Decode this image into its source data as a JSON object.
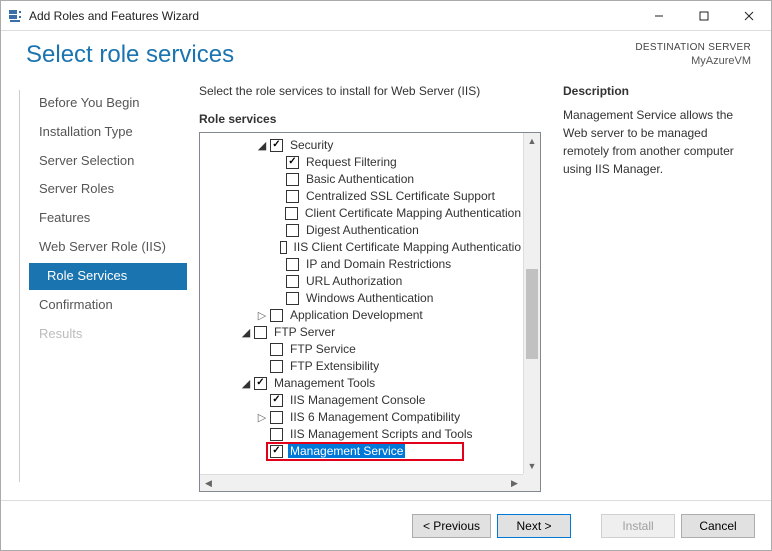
{
  "window": {
    "title": "Add Roles and Features Wizard"
  },
  "header": {
    "pageTitle": "Select role services",
    "destLabel": "DESTINATION SERVER",
    "destName": "MyAzureVM"
  },
  "steps": [
    {
      "label": "Before You Begin",
      "state": "normal"
    },
    {
      "label": "Installation Type",
      "state": "normal"
    },
    {
      "label": "Server Selection",
      "state": "normal"
    },
    {
      "label": "Server Roles",
      "state": "normal"
    },
    {
      "label": "Features",
      "state": "normal"
    },
    {
      "label": "Web Server Role (IIS)",
      "state": "normal"
    },
    {
      "label": "Role Services",
      "state": "active"
    },
    {
      "label": "Confirmation",
      "state": "normal"
    },
    {
      "label": "Results",
      "state": "disabled"
    }
  ],
  "instruction": "Select the role services to install for Web Server (IIS)",
  "rolesLabel": "Role services",
  "tree": [
    {
      "depth": 3,
      "expander": "▲",
      "checked": true,
      "label": "Security"
    },
    {
      "depth": 4,
      "expander": "",
      "checked": true,
      "label": "Request Filtering"
    },
    {
      "depth": 4,
      "expander": "",
      "checked": false,
      "label": "Basic Authentication"
    },
    {
      "depth": 4,
      "expander": "",
      "checked": false,
      "label": "Centralized SSL Certificate Support"
    },
    {
      "depth": 4,
      "expander": "",
      "checked": false,
      "label": "Client Certificate Mapping Authentication"
    },
    {
      "depth": 4,
      "expander": "",
      "checked": false,
      "label": "Digest Authentication"
    },
    {
      "depth": 4,
      "expander": "",
      "checked": false,
      "label": "IIS Client Certificate Mapping Authenticatio"
    },
    {
      "depth": 4,
      "expander": "",
      "checked": false,
      "label": "IP and Domain Restrictions"
    },
    {
      "depth": 4,
      "expander": "",
      "checked": false,
      "label": "URL Authorization"
    },
    {
      "depth": 4,
      "expander": "",
      "checked": false,
      "label": "Windows Authentication"
    },
    {
      "depth": 3,
      "expander": "▷",
      "checked": false,
      "label": "Application Development"
    },
    {
      "depth": 2,
      "expander": "▲",
      "checked": false,
      "label": "FTP Server"
    },
    {
      "depth": 3,
      "expander": "",
      "checked": false,
      "label": "FTP Service"
    },
    {
      "depth": 3,
      "expander": "",
      "checked": false,
      "label": "FTP Extensibility"
    },
    {
      "depth": 2,
      "expander": "▲",
      "checked": true,
      "label": "Management Tools"
    },
    {
      "depth": 3,
      "expander": "",
      "checked": true,
      "label": "IIS Management Console"
    },
    {
      "depth": 3,
      "expander": "▷",
      "checked": false,
      "label": "IIS 6 Management Compatibility"
    },
    {
      "depth": 3,
      "expander": "",
      "checked": false,
      "label": "IIS Management Scripts and Tools"
    },
    {
      "depth": 3,
      "expander": "",
      "checked": true,
      "label": "Management Service",
      "selected": true,
      "highlight": true
    }
  ],
  "description": {
    "heading": "Description",
    "text": "Management Service allows the Web server to be managed remotely from another computer using IIS Manager."
  },
  "buttons": {
    "previous": "< Previous",
    "next": "Next >",
    "install": "Install",
    "cancel": "Cancel"
  }
}
